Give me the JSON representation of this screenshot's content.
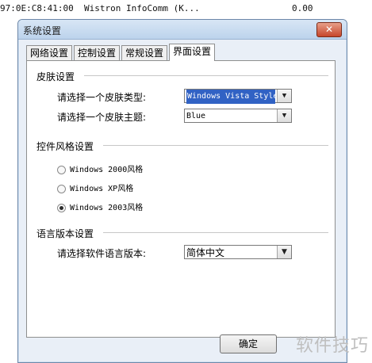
{
  "background_row": {
    "mac": "97:0E:C8:41:00",
    "vendor": "Wistron InfoComm (K...",
    "value": "0.00"
  },
  "dialog": {
    "title": "系统设置",
    "close_glyph": "✕",
    "tabs": [
      {
        "label": "网络设置",
        "active": false
      },
      {
        "label": "控制设置",
        "active": false
      },
      {
        "label": "常规设置",
        "active": false
      },
      {
        "label": "界面设置",
        "active": true
      }
    ],
    "skin_group": {
      "title": "皮肤设置",
      "type_label": "请选择一个皮肤类型:",
      "type_value": "Windows Vista Style",
      "theme_label": "请选择一个皮肤主题:",
      "theme_value": "Blue"
    },
    "control_style_group": {
      "title": "控件风格设置",
      "options": [
        {
          "label": "Windows 2000风格",
          "checked": false
        },
        {
          "label": "Windows XP风格",
          "checked": false
        },
        {
          "label": "Windows 2003风格",
          "checked": true
        }
      ]
    },
    "language_group": {
      "title": "语言版本设置",
      "label": "请选择软件语言版本:",
      "value": "简体中文"
    },
    "ok_label": "确定",
    "dropdown_glyph": "▼"
  },
  "watermark": "软件技巧",
  "colors": {
    "selection": "#3162c4",
    "close_button": "#c6452a"
  }
}
